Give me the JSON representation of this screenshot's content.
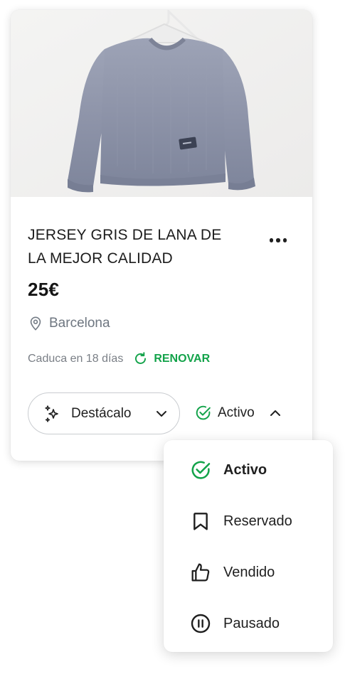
{
  "listing": {
    "title_line1": "JERSEY GRIS DE LANA DE",
    "title_line2": "LA MEJOR CALIDAD",
    "price": "25€",
    "location": "Barcelona",
    "expiry_text": "Caduca en 18 días",
    "renew_label": "RENOVAR"
  },
  "actions": {
    "feature_label": "Destácalo",
    "status_label": "Activo"
  },
  "status_menu": {
    "items": [
      {
        "label": "Activo",
        "icon": "check-circle-icon",
        "selected": true
      },
      {
        "label": "Reservado",
        "icon": "bookmark-icon",
        "selected": false
      },
      {
        "label": "Vendido",
        "icon": "thumbs-up-icon",
        "selected": false
      },
      {
        "label": "Pausado",
        "icon": "pause-circle-icon",
        "selected": false
      }
    ]
  },
  "colors": {
    "accent_green": "#13a34a",
    "text_dark": "#1f1f1f",
    "text_muted": "#7a7f86"
  }
}
